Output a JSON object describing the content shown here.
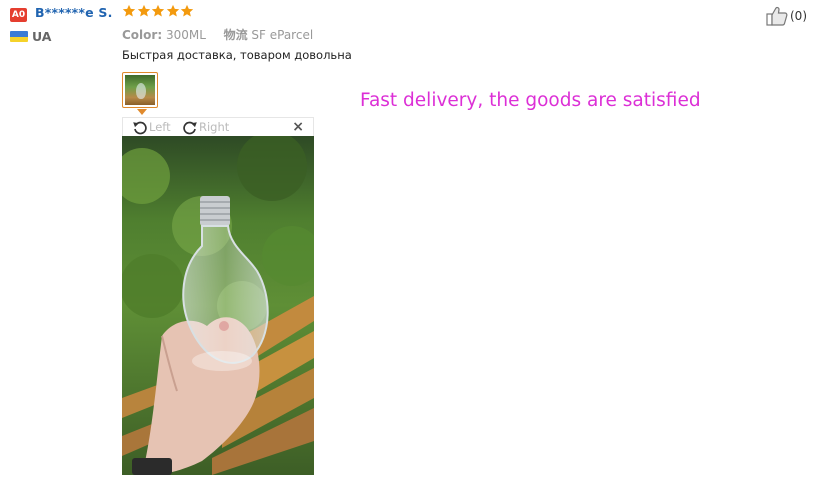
{
  "reviewer": {
    "badge": "A0",
    "name": "B******e S.",
    "rating": 5,
    "country": "UA"
  },
  "order_info": {
    "color_label": "Color:",
    "color_value": "300ML",
    "shipping_label": "物流",
    "shipping_value": "SF eParcel"
  },
  "review": {
    "text": "Быстрая доставка, товаром довольна",
    "translation": "Fast delivery, the goods are satisfied"
  },
  "viewer": {
    "rotate_left_label": "Left",
    "rotate_right_label": "Right",
    "close_glyph": "×"
  },
  "helpful": {
    "count": "(0)"
  },
  "colors": {
    "badge": "#e53e2f",
    "name": "#1f63b0",
    "star": "#f39a0e",
    "translation": "#dc2fd6",
    "thumb_border": "#e08a2d"
  },
  "icons": [
    "star-icon",
    "ukraine-flag-icon",
    "rotate-left-icon",
    "rotate-right-icon",
    "close-icon",
    "thumbs-up-icon"
  ]
}
